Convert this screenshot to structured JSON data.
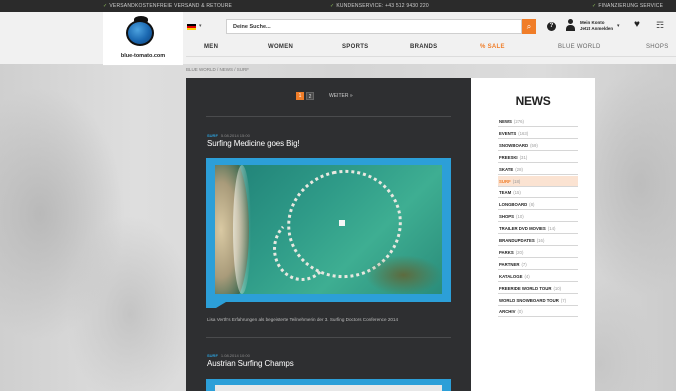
{
  "topbar": {
    "left": "VERSANDKOSTENFREIE VERSAND & RETOURE",
    "center": "KUNDENSERVICE: +43 512 9430 220",
    "right": "FINANZIERUNG SERVICE"
  },
  "header": {
    "logo_text": "blue-tomato.com",
    "language_caret": "▾",
    "search_placeholder": "Deine Suche...",
    "search_icon": "⌕",
    "help_icon": "?",
    "user_line1": "Mein Konto",
    "user_line2": "Jetzt Anmelden",
    "user_caret": "▾",
    "heart_icon": "♥",
    "cart_icon": "☶"
  },
  "nav": {
    "items": [
      "MEN",
      "WOMEN",
      "SPORTS",
      "BRANDS",
      "% SALE",
      "BLUE WORLD",
      "SHOPS"
    ]
  },
  "breadcrumb": "BLUE WORLD  /  NEWS  /  SURF",
  "pager": {
    "page1": "1",
    "page2": "2",
    "next": "WEITER »"
  },
  "posts": [
    {
      "category": "SURF",
      "date": "5.08.2014 15:00",
      "title": "Surfing Medicine goes Big!",
      "caption": "Lisa Verth's Erfahrungen als begeisterte Teilnehmerin der 3. Surfing Doctors Conference 2014"
    },
    {
      "category": "SURF",
      "date": "1.08.2014 10:00",
      "title": "Austrian Surfing Champs"
    }
  ],
  "sidebar": {
    "title": "NEWS",
    "items": [
      {
        "label": "NEWS",
        "count": "(276)"
      },
      {
        "label": "EVENTS",
        "count": "(163)"
      },
      {
        "label": "SNOWBOARD",
        "count": "(59)"
      },
      {
        "label": "FREESKI",
        "count": "(31)"
      },
      {
        "label": "SKATE",
        "count": "(28)"
      },
      {
        "label": "SURF",
        "count": "(18)",
        "active": true
      },
      {
        "label": "TEAM",
        "count": "(15)"
      },
      {
        "label": "LONGBOARD",
        "count": "(8)"
      },
      {
        "label": "SHOPS",
        "count": "(10)"
      },
      {
        "label": "TRAILER DVD MOVIES",
        "count": "(14)"
      },
      {
        "label": "BRANDUPDATES",
        "count": "(16)"
      },
      {
        "label": "PARKS",
        "count": "(20)"
      },
      {
        "label": "PARTNER",
        "count": "(7)"
      },
      {
        "label": "KATALOGE",
        "count": "(4)"
      },
      {
        "label": "FREERIDE WORLD TOUR",
        "count": "(10)"
      },
      {
        "label": "WORLD SNOWBOARD TOUR",
        "count": "(7)"
      },
      {
        "label": "ARCHIV",
        "count": "(0)"
      }
    ]
  },
  "colors": {
    "accent": "#f07d28",
    "blue": "#2c9fd8",
    "dark": "#2e2f31"
  }
}
